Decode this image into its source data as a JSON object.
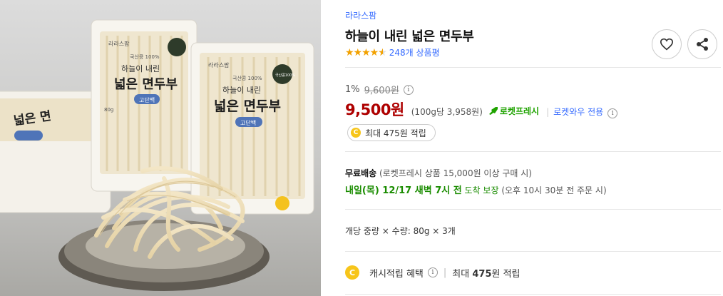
{
  "brand": "라라스팜",
  "product": {
    "title": "하늘이 내린 넓은 면두부",
    "review_count": "248개 상품평",
    "rating": 4.5
  },
  "pricing": {
    "discount_rate": "1%",
    "original_price": "9,600원",
    "price": "9,500원",
    "unit_price": "(100g당 3,958원)",
    "rocket_label": "로켓프레시",
    "rocket_wow": "로켓와우 전용"
  },
  "cash_badge": "최대 475원 적립",
  "shipping": {
    "free_label": "무료배송",
    "free_condition": "(로켓프레시 상품 15,000원 이상 구매 시)",
    "arrival_bold": "내일(목) 12/17 새벽 7시 전",
    "arrival_guarantee": "도착 보장",
    "arrival_note": "(오후 10시 30분 전 주문 시)"
  },
  "spec": "개당 중량 × 수량: 80g × 3개",
  "cash_benefit": {
    "label": "캐시적립 혜택",
    "value_prefix": "최대 ",
    "value_amount": "475",
    "value_suffix": "원 적립"
  },
  "image": {
    "package_brand": "라라스팜",
    "package_small": "국산콩 100%",
    "package_line1": "하늘이 내린",
    "package_line2": "넓은 면두부",
    "package_tag": "고단백",
    "package_weight": "80g",
    "seal": "국산콩100%"
  },
  "icons": {
    "wishlist": "heart-icon",
    "share": "share-icon",
    "coin": "C",
    "info": "i"
  },
  "colors": {
    "price": "#ae0000",
    "link": "#346aff",
    "rocket": "#1fa300",
    "star": "#f2a100"
  }
}
